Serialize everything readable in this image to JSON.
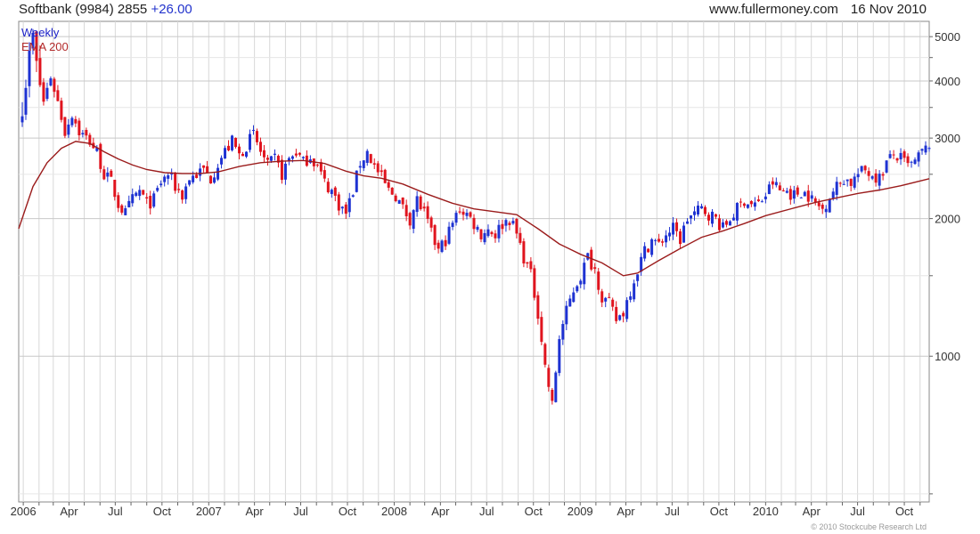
{
  "header": {
    "symbol": "Softbank (9984) 2855",
    "change": "+26.00",
    "site": "www.fullermoney.com",
    "date": "16 Nov 2010"
  },
  "legend": {
    "period": "Weekly",
    "indicator": "EMA 200"
  },
  "credit": "© 2010 Stockcube Research Ltd",
  "colors": {
    "up": "#1e32d2",
    "down": "#e0141e",
    "ema": "#9b1c1c",
    "grid": "#d8d8d8",
    "axis": "#666666"
  },
  "chart_data": {
    "type": "candlestick",
    "interval": "weekly",
    "y_scale": "log",
    "ylim": [
      480,
      5400
    ],
    "y_ticks": [
      1000,
      2000,
      3000,
      4000,
      5000
    ],
    "x_tick_labels": [
      "2006",
      "Apr",
      "Jul",
      "Oct",
      "2007",
      "Apr",
      "Jul",
      "Oct",
      "2008",
      "Apr",
      "Jul",
      "Oct",
      "2009",
      "Apr",
      "Jul",
      "Oct",
      "2010",
      "Apr",
      "Jul",
      "Oct"
    ],
    "x_start": "2005-12-23",
    "x_end": "2010-11-19",
    "close_points": [
      [
        "2005-12-30",
        3600
      ],
      [
        "2006-01-13",
        4500
      ],
      [
        "2006-01-20",
        5000
      ],
      [
        "2006-01-27",
        4300
      ],
      [
        "2006-02-10",
        3600
      ],
      [
        "2006-02-24",
        4100
      ],
      [
        "2006-03-10",
        3600
      ],
      [
        "2006-03-24",
        3100
      ],
      [
        "2006-04-07",
        3400
      ],
      [
        "2006-04-21",
        3100
      ],
      [
        "2006-05-12",
        2950
      ],
      [
        "2006-05-26",
        2800
      ],
      [
        "2006-06-09",
        2500
      ],
      [
        "2006-06-23",
        2400
      ],
      [
        "2006-07-07",
        2150
      ],
      [
        "2006-07-21",
        2050
      ],
      [
        "2006-08-04",
        2200
      ],
      [
        "2006-08-18",
        2300
      ],
      [
        "2006-09-01",
        2150
      ],
      [
        "2006-09-15",
        2200
      ],
      [
        "2006-09-29",
        2400
      ],
      [
        "2006-10-13",
        2500
      ],
      [
        "2006-10-27",
        2350
      ],
      [
        "2006-11-10",
        2250
      ],
      [
        "2006-11-24",
        2450
      ],
      [
        "2006-12-08",
        2500
      ],
      [
        "2006-12-22",
        2550
      ],
      [
        "2007-01-05",
        2450
      ],
      [
        "2007-01-19",
        2650
      ],
      [
        "2007-02-02",
        2800
      ],
      [
        "2007-02-16",
        2950
      ],
      [
        "2007-03-02",
        2750
      ],
      [
        "2007-03-16",
        2900
      ],
      [
        "2007-03-30",
        3050
      ],
      [
        "2007-04-13",
        2800
      ],
      [
        "2007-04-27",
        2600
      ],
      [
        "2007-05-11",
        2700
      ],
      [
        "2007-05-25",
        2500
      ],
      [
        "2007-06-08",
        2700
      ],
      [
        "2007-06-22",
        2800
      ],
      [
        "2007-07-06",
        2650
      ],
      [
        "2007-07-20",
        2750
      ],
      [
        "2007-08-03",
        2600
      ],
      [
        "2007-08-17",
        2400
      ],
      [
        "2007-08-31",
        2300
      ],
      [
        "2007-09-14",
        2150
      ],
      [
        "2007-09-28",
        2050
      ],
      [
        "2007-10-12",
        2300
      ],
      [
        "2007-10-26",
        2650
      ],
      [
        "2007-11-09",
        2800
      ],
      [
        "2007-11-23",
        2600
      ],
      [
        "2007-12-07",
        2450
      ],
      [
        "2007-12-21",
        2300
      ],
      [
        "2008-01-04",
        2250
      ],
      [
        "2008-01-18",
        2100
      ],
      [
        "2008-02-01",
        2000
      ],
      [
        "2008-02-15",
        2200
      ],
      [
        "2008-02-29",
        2050
      ],
      [
        "2008-03-14",
        1850
      ],
      [
        "2008-03-28",
        1700
      ],
      [
        "2008-04-11",
        1800
      ],
      [
        "2008-04-25",
        1950
      ],
      [
        "2008-05-09",
        2100
      ],
      [
        "2008-05-23",
        2050
      ],
      [
        "2008-06-06",
        1950
      ],
      [
        "2008-06-20",
        1850
      ],
      [
        "2008-07-04",
        1900
      ],
      [
        "2008-07-18",
        1850
      ],
      [
        "2008-08-01",
        1950
      ],
      [
        "2008-08-15",
        2000
      ],
      [
        "2008-08-29",
        1850
      ],
      [
        "2008-09-12",
        1650
      ],
      [
        "2008-09-26",
        1500
      ],
      [
        "2008-10-10",
        1250
      ],
      [
        "2008-10-24",
        950
      ],
      [
        "2008-11-07",
        780
      ],
      [
        "2008-11-21",
        1100
      ],
      [
        "2008-12-05",
        1250
      ],
      [
        "2008-12-19",
        1400
      ],
      [
        "2009-01-02",
        1500
      ],
      [
        "2009-01-16",
        1650
      ],
      [
        "2009-01-30",
        1550
      ],
      [
        "2009-02-13",
        1350
      ],
      [
        "2009-02-27",
        1300
      ],
      [
        "2009-03-13",
        1200
      ],
      [
        "2009-03-27",
        1250
      ],
      [
        "2009-04-10",
        1400
      ],
      [
        "2009-04-24",
        1550
      ],
      [
        "2009-05-08",
        1700
      ],
      [
        "2009-05-22",
        1800
      ],
      [
        "2009-06-05",
        1750
      ],
      [
        "2009-06-19",
        1850
      ],
      [
        "2009-07-03",
        1900
      ],
      [
        "2009-07-17",
        1800
      ],
      [
        "2009-07-31",
        2000
      ],
      [
        "2009-08-14",
        2050
      ],
      [
        "2009-08-28",
        2100
      ],
      [
        "2009-09-11",
        2050
      ],
      [
        "2009-09-25",
        2000
      ],
      [
        "2009-10-09",
        1900
      ],
      [
        "2009-10-23",
        2000
      ],
      [
        "2009-11-06",
        2100
      ],
      [
        "2009-11-20",
        2200
      ],
      [
        "2009-12-04",
        2150
      ],
      [
        "2009-12-18",
        2150
      ],
      [
        "2010-01-01",
        2250
      ],
      [
        "2010-01-15",
        2400
      ],
      [
        "2010-01-29",
        2300
      ],
      [
        "2010-02-12",
        2300
      ],
      [
        "2010-02-26",
        2250
      ],
      [
        "2010-03-12",
        2300
      ],
      [
        "2010-03-26",
        2250
      ],
      [
        "2010-04-09",
        2150
      ],
      [
        "2010-04-23",
        2100
      ],
      [
        "2010-05-07",
        2250
      ],
      [
        "2010-05-21",
        2350
      ],
      [
        "2010-06-04",
        2450
      ],
      [
        "2010-06-18",
        2400
      ],
      [
        "2010-07-02",
        2500
      ],
      [
        "2010-07-16",
        2550
      ],
      [
        "2010-07-30",
        2500
      ],
      [
        "2010-08-13",
        2450
      ],
      [
        "2010-08-27",
        2650
      ],
      [
        "2010-09-10",
        2750
      ],
      [
        "2010-09-24",
        2700
      ],
      [
        "2010-10-08",
        2600
      ],
      [
        "2010-10-22",
        2650
      ],
      [
        "2010-11-05",
        2800
      ],
      [
        "2010-11-19",
        2855
      ]
    ],
    "ema_points": [
      [
        "2005-12-23",
        1900
      ],
      [
        "2006-01-20",
        2350
      ],
      [
        "2006-02-17",
        2650
      ],
      [
        "2006-03-17",
        2850
      ],
      [
        "2006-04-14",
        2950
      ],
      [
        "2006-05-12",
        2920
      ],
      [
        "2006-06-09",
        2800
      ],
      [
        "2006-07-07",
        2700
      ],
      [
        "2006-08-04",
        2620
      ],
      [
        "2006-09-01",
        2560
      ],
      [
        "2006-10-06",
        2520
      ],
      [
        "2006-11-10",
        2510
      ],
      [
        "2006-12-15",
        2510
      ],
      [
        "2007-01-19",
        2530
      ],
      [
        "2007-03-02",
        2600
      ],
      [
        "2007-04-13",
        2650
      ],
      [
        "2007-05-25",
        2670
      ],
      [
        "2007-07-06",
        2680
      ],
      [
        "2007-08-17",
        2640
      ],
      [
        "2007-09-28",
        2540
      ],
      [
        "2007-11-02",
        2480
      ],
      [
        "2007-12-07",
        2450
      ],
      [
        "2008-01-18",
        2380
      ],
      [
        "2008-03-07",
        2260
      ],
      [
        "2008-04-25",
        2160
      ],
      [
        "2008-06-06",
        2100
      ],
      [
        "2008-07-18",
        2070
      ],
      [
        "2008-08-29",
        2040
      ],
      [
        "2008-10-10",
        1900
      ],
      [
        "2008-11-21",
        1760
      ],
      [
        "2009-01-02",
        1670
      ],
      [
        "2009-02-13",
        1600
      ],
      [
        "2009-03-27",
        1500
      ],
      [
        "2009-04-24",
        1520
      ],
      [
        "2009-06-05",
        1620
      ],
      [
        "2009-07-17",
        1720
      ],
      [
        "2009-08-28",
        1820
      ],
      [
        "2009-10-09",
        1880
      ],
      [
        "2009-11-20",
        1950
      ],
      [
        "2010-01-01",
        2030
      ],
      [
        "2010-02-26",
        2110
      ],
      [
        "2010-04-09",
        2170
      ],
      [
        "2010-05-21",
        2220
      ],
      [
        "2010-07-02",
        2270
      ],
      [
        "2010-08-13",
        2310
      ],
      [
        "2010-09-24",
        2360
      ],
      [
        "2010-11-19",
        2445
      ]
    ]
  }
}
